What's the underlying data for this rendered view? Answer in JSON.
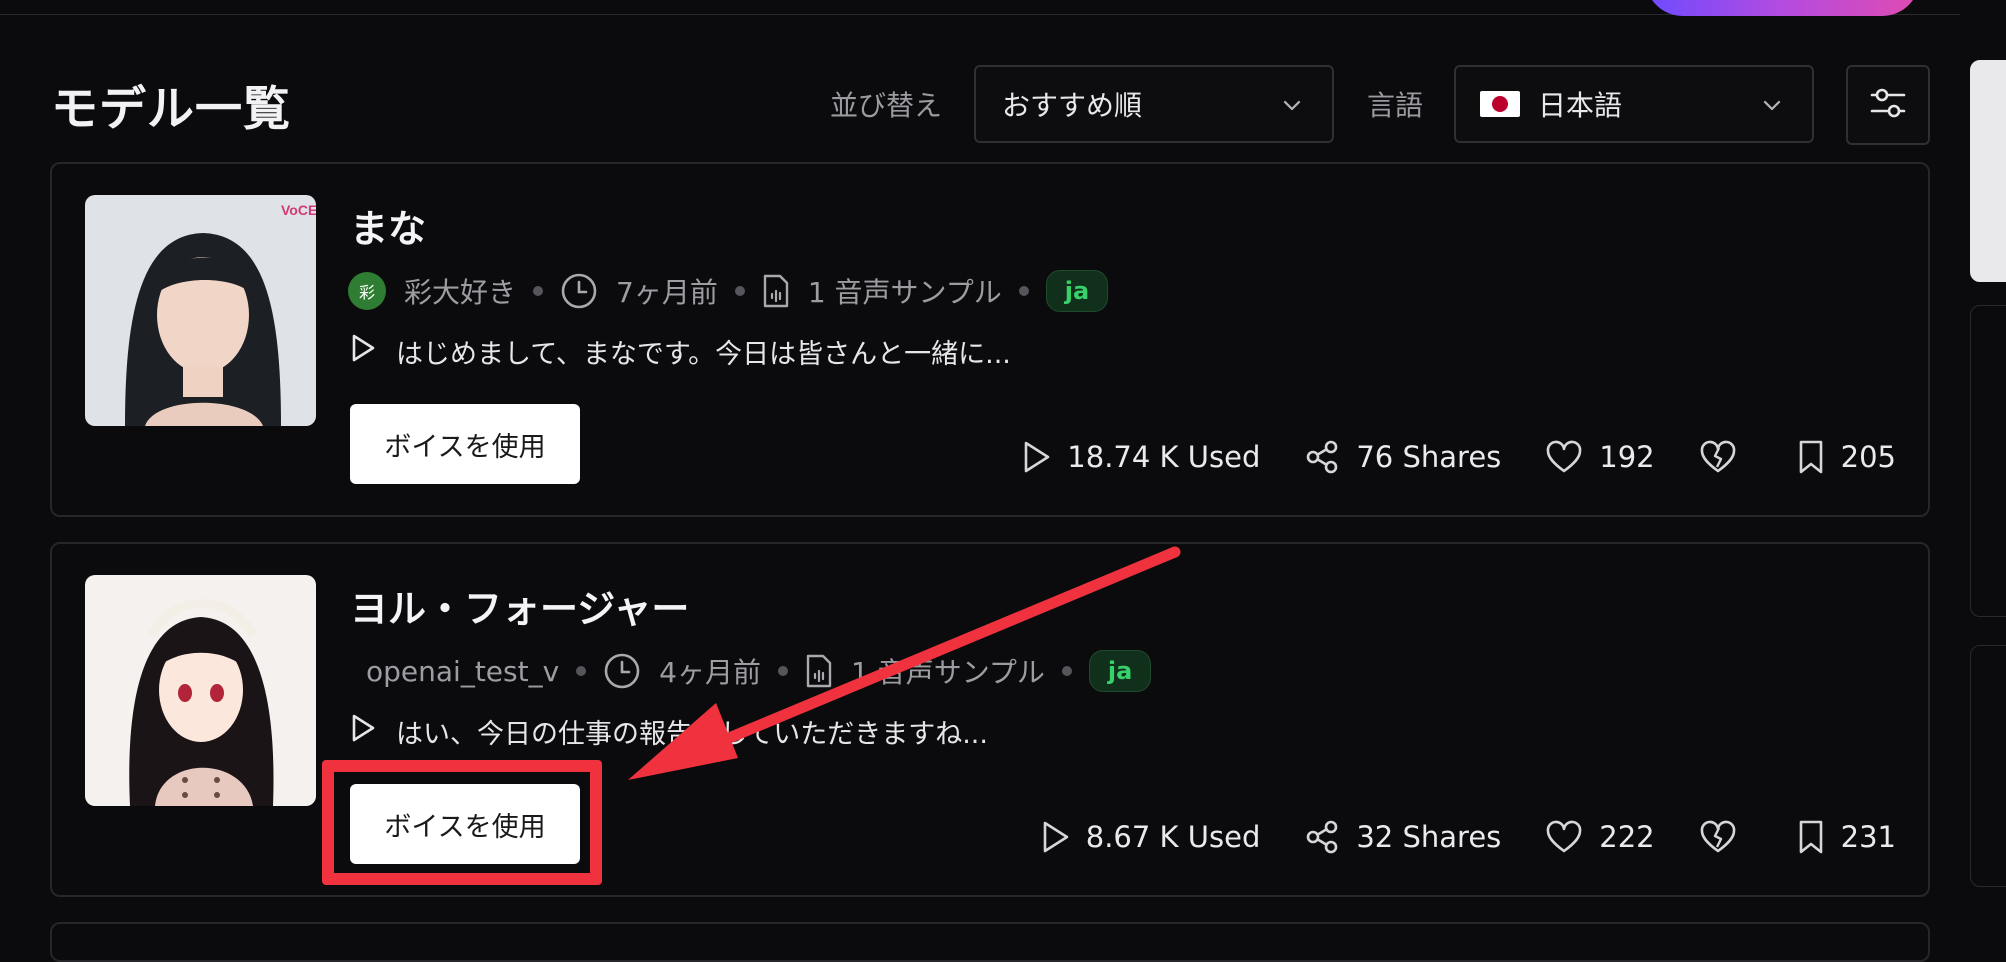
{
  "header": {
    "title": "モデル一覧",
    "sort_label": "並び替え",
    "sort_value": "おすすめ順",
    "lang_label": "言語",
    "lang_value": "日本語"
  },
  "models": [
    {
      "name": "まな",
      "author": "彩大好き",
      "author_initial": "彩",
      "time": "7ヶ月前",
      "samples": "1 音声サンプル",
      "lang": "ja",
      "sample_text": "はじめまして、まなです。今日は皆さんと一緒に...",
      "use_label": "ボイスを使用",
      "used": "18.74 K Used",
      "shares": "76 Shares",
      "likes": "192",
      "saves": "205",
      "avatar_bg": "#dfe3e8"
    },
    {
      "name": "ヨル・フォージャー",
      "author": "openai_test_v",
      "time": "4ヶ月前",
      "samples": "1 音声サンプル",
      "lang": "ja",
      "sample_text": "はい、今日の仕事の報告をしていただきますね...",
      "use_label": "ボイスを使用",
      "used": "8.67 K Used",
      "shares": "32 Shares",
      "likes": "222",
      "saves": "231",
      "avatar_bg": "#f4f1ee"
    }
  ],
  "annotation": {
    "color": "#f0323f"
  }
}
